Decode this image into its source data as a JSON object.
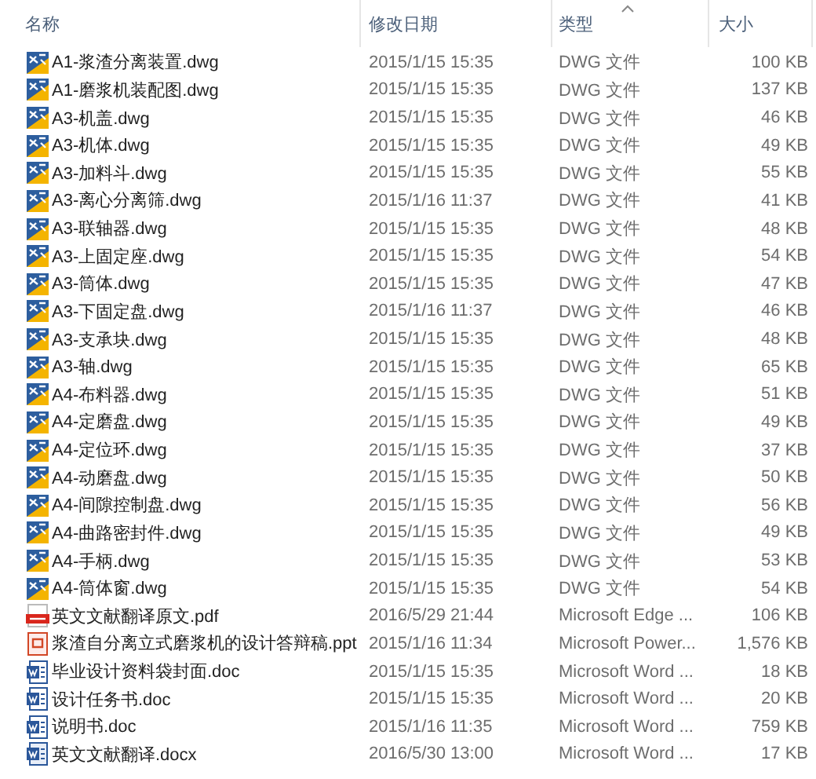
{
  "columns": [
    {
      "label": "名称",
      "sorted": false
    },
    {
      "label": "修改日期",
      "sorted": false
    },
    {
      "label": "类型",
      "sorted": true
    },
    {
      "label": "大小",
      "sorted": false
    }
  ],
  "files": [
    {
      "kind": "dwg",
      "name": "A1-浆渣分离装置.dwg",
      "modified": "2015/1/15 15:35",
      "type": "DWG 文件",
      "size": "100 KB"
    },
    {
      "kind": "dwg",
      "name": "A1-磨浆机装配图.dwg",
      "modified": "2015/1/15 15:35",
      "type": "DWG 文件",
      "size": "137 KB"
    },
    {
      "kind": "dwg",
      "name": "A3-机盖.dwg",
      "modified": "2015/1/15 15:35",
      "type": "DWG 文件",
      "size": "46 KB"
    },
    {
      "kind": "dwg",
      "name": "A3-机体.dwg",
      "modified": "2015/1/15 15:35",
      "type": "DWG 文件",
      "size": "49 KB"
    },
    {
      "kind": "dwg",
      "name": "A3-加料斗.dwg",
      "modified": "2015/1/15 15:35",
      "type": "DWG 文件",
      "size": "55 KB"
    },
    {
      "kind": "dwg",
      "name": "A3-离心分离筛.dwg",
      "modified": "2015/1/16 11:37",
      "type": "DWG 文件",
      "size": "41 KB"
    },
    {
      "kind": "dwg",
      "name": "A3-联轴器.dwg",
      "modified": "2015/1/15 15:35",
      "type": "DWG 文件",
      "size": "48 KB"
    },
    {
      "kind": "dwg",
      "name": "A3-上固定座.dwg",
      "modified": "2015/1/15 15:35",
      "type": "DWG 文件",
      "size": "54 KB"
    },
    {
      "kind": "dwg",
      "name": "A3-筒体.dwg",
      "modified": "2015/1/15 15:35",
      "type": "DWG 文件",
      "size": "47 KB"
    },
    {
      "kind": "dwg",
      "name": "A3-下固定盘.dwg",
      "modified": "2015/1/16 11:37",
      "type": "DWG 文件",
      "size": "46 KB"
    },
    {
      "kind": "dwg",
      "name": "A3-支承块.dwg",
      "modified": "2015/1/15 15:35",
      "type": "DWG 文件",
      "size": "48 KB"
    },
    {
      "kind": "dwg",
      "name": "A3-轴.dwg",
      "modified": "2015/1/15 15:35",
      "type": "DWG 文件",
      "size": "65 KB"
    },
    {
      "kind": "dwg",
      "name": "A4-布料器.dwg",
      "modified": "2015/1/15 15:35",
      "type": "DWG 文件",
      "size": "51 KB"
    },
    {
      "kind": "dwg",
      "name": "A4-定磨盘.dwg",
      "modified": "2015/1/15 15:35",
      "type": "DWG 文件",
      "size": "49 KB"
    },
    {
      "kind": "dwg",
      "name": "A4-定位环.dwg",
      "modified": "2015/1/15 15:35",
      "type": "DWG 文件",
      "size": "37 KB"
    },
    {
      "kind": "dwg",
      "name": "A4-动磨盘.dwg",
      "modified": "2015/1/15 15:35",
      "type": "DWG 文件",
      "size": "50 KB"
    },
    {
      "kind": "dwg",
      "name": "A4-间隙控制盘.dwg",
      "modified": "2015/1/15 15:35",
      "type": "DWG 文件",
      "size": "56 KB"
    },
    {
      "kind": "dwg",
      "name": "A4-曲路密封件.dwg",
      "modified": "2015/1/15 15:35",
      "type": "DWG 文件",
      "size": "49 KB"
    },
    {
      "kind": "dwg",
      "name": "A4-手柄.dwg",
      "modified": "2015/1/15 15:35",
      "type": "DWG 文件",
      "size": "53 KB"
    },
    {
      "kind": "dwg",
      "name": "A4-筒体窗.dwg",
      "modified": "2015/1/15 15:35",
      "type": "DWG 文件",
      "size": "54 KB"
    },
    {
      "kind": "pdf",
      "name": "英文文献翻译原文.pdf",
      "modified": "2016/5/29 21:44",
      "type": "Microsoft Edge ...",
      "size": "106 KB"
    },
    {
      "kind": "ppt",
      "name": "浆渣自分离立式磨浆机的设计答辩稿.ppt",
      "modified": "2015/1/16 11:34",
      "type": "Microsoft Power...",
      "size": "1,576 KB"
    },
    {
      "kind": "doc",
      "name": "毕业设计资料袋封面.doc",
      "modified": "2015/1/15 15:35",
      "type": "Microsoft Word ...",
      "size": "18 KB"
    },
    {
      "kind": "doc",
      "name": "设计任务书.doc",
      "modified": "2015/1/15 15:35",
      "type": "Microsoft Word ...",
      "size": "20 KB"
    },
    {
      "kind": "doc",
      "name": "说明书.doc",
      "modified": "2015/1/16 11:35",
      "type": "Microsoft Word ...",
      "size": "759 KB"
    },
    {
      "kind": "docx",
      "name": "英文文献翻译.docx",
      "modified": "2016/5/30 13:00",
      "type": "Microsoft Word ...",
      "size": "17 KB"
    }
  ]
}
